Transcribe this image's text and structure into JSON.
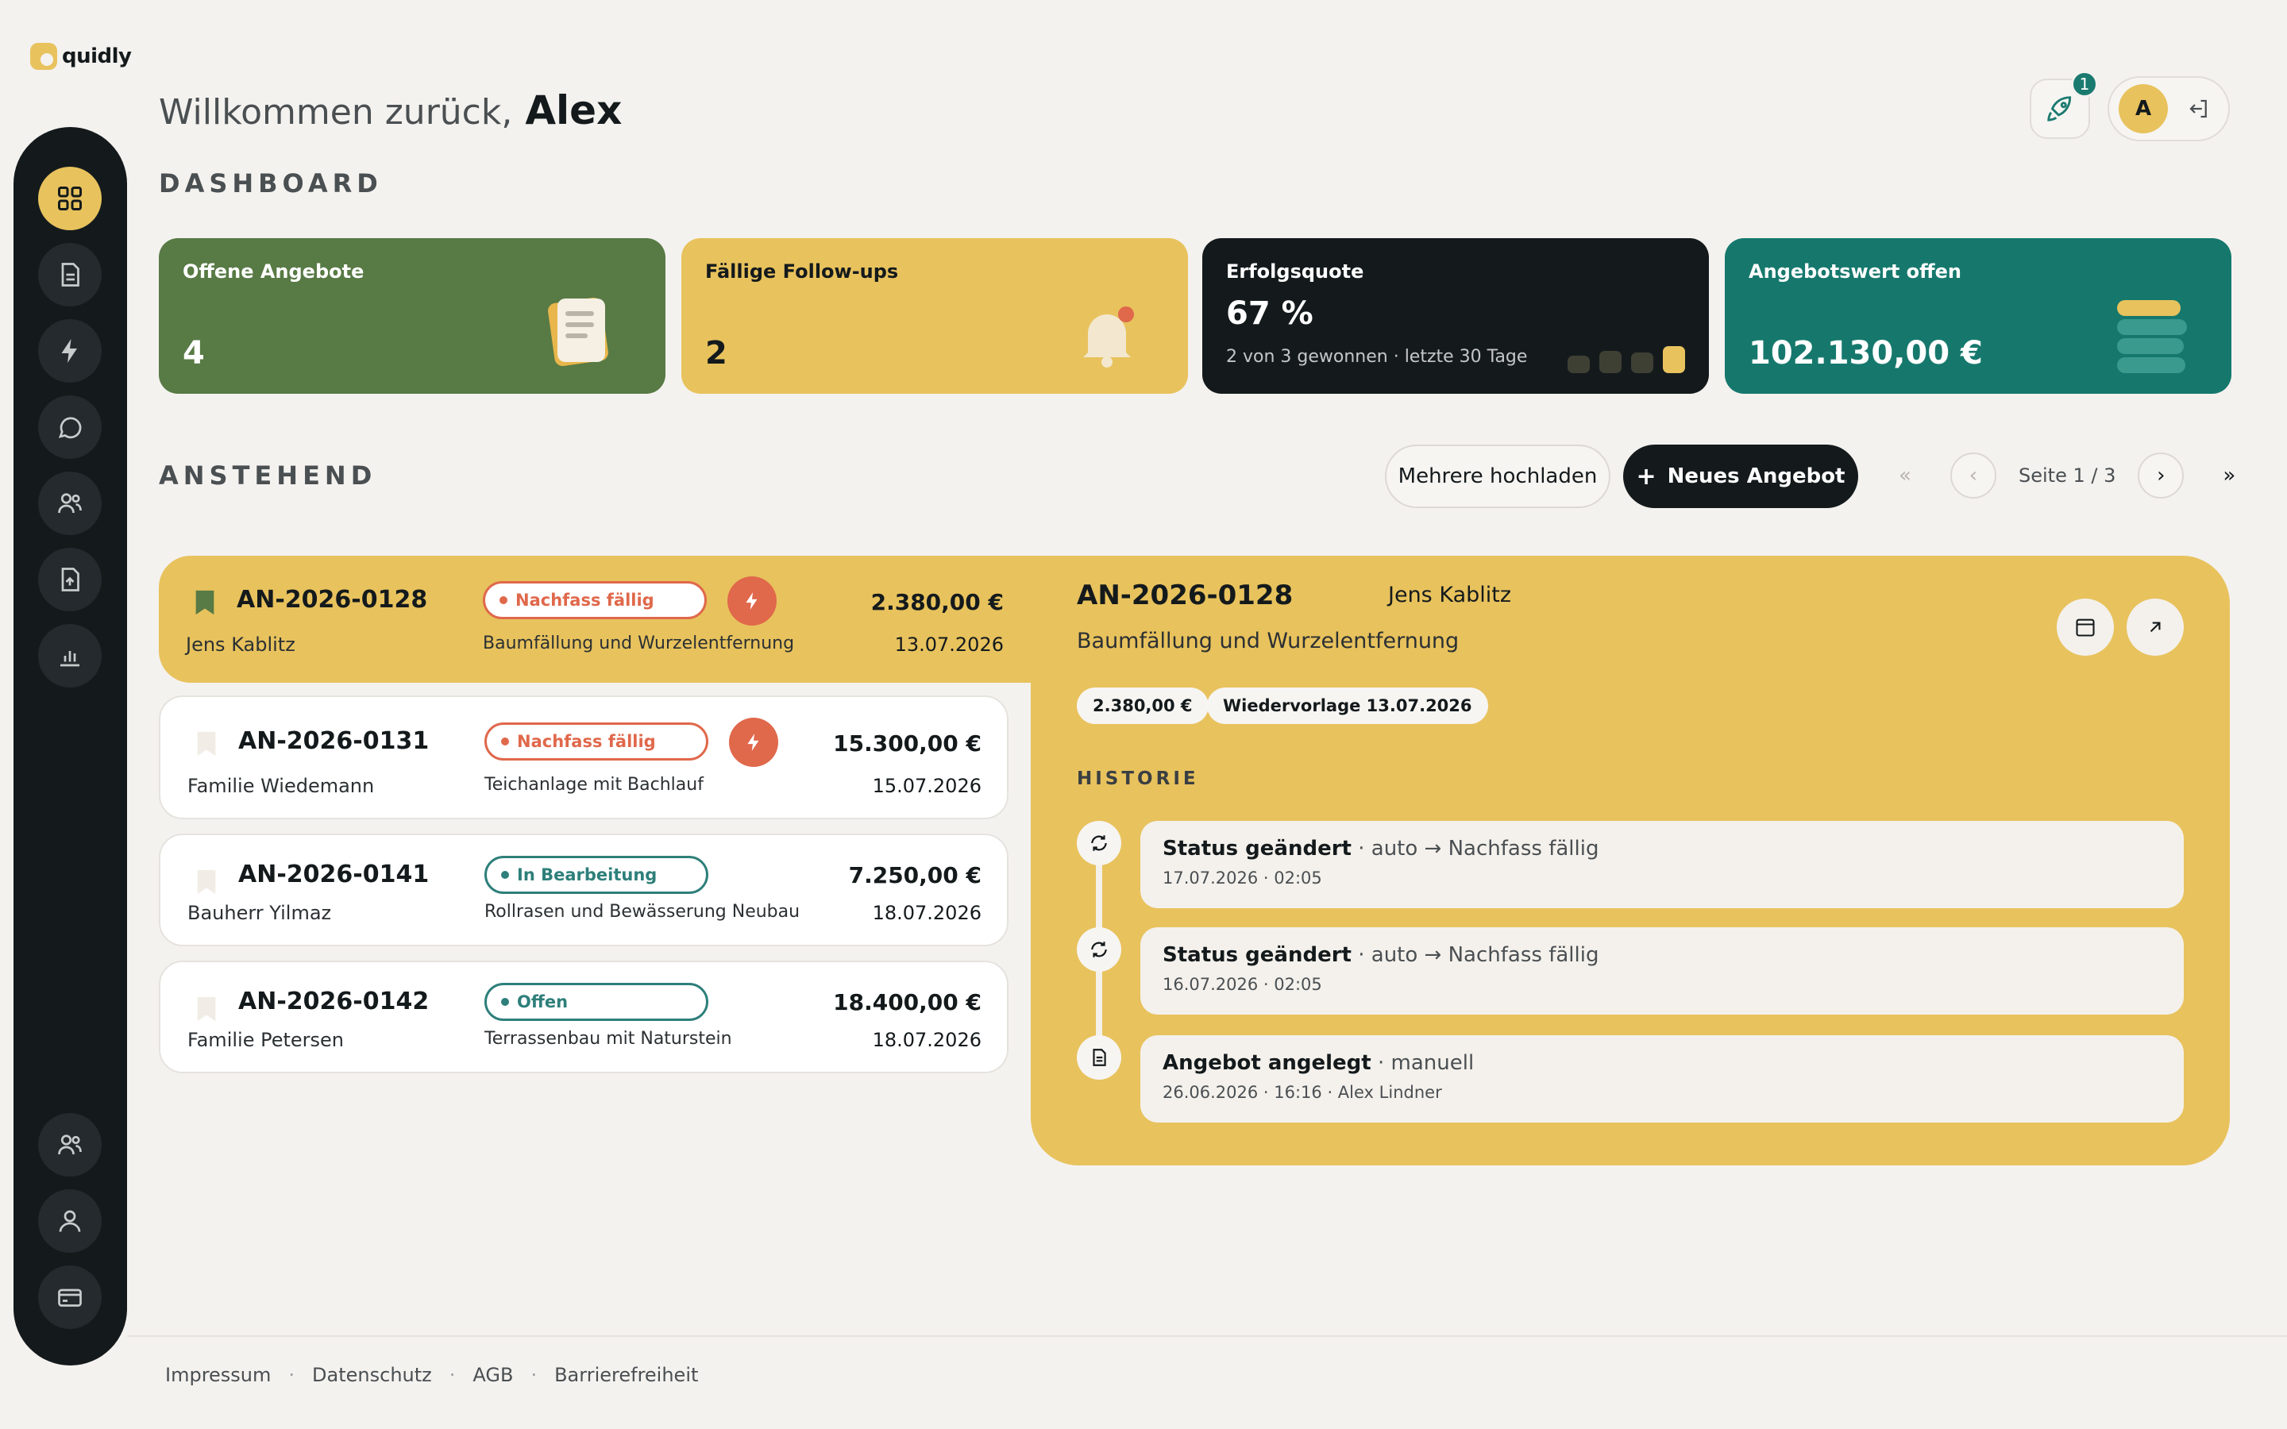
{
  "app": {
    "brand": "quidly"
  },
  "header": {
    "greeting": "Willkommen zurück,",
    "user_name": "Alex",
    "notification_count": "1",
    "avatar_initial": "A"
  },
  "dashboard": {
    "title": "DASHBOARD",
    "cards": [
      {
        "label": "Offene Angebote",
        "value": "4",
        "color": "#587a45"
      },
      {
        "label": "Fällige Follow-ups",
        "value": "2",
        "color": "#e8c25d"
      },
      {
        "label": "Erfolgsquote",
        "value": "67 %",
        "sub": "2 von 3 gewonnen · letzte 30 Tage",
        "color": "#141a1c"
      },
      {
        "label": "Angebotswert offen",
        "value": "102.130,00 €",
        "color": "#16786d"
      }
    ]
  },
  "pending": {
    "title": "ANSTEHEND",
    "upload_label": "Mehrere hochladen",
    "new_label": "Neues Angebot",
    "page_label": "Seite 1 / 3",
    "rows": [
      {
        "id": "AN-2026-0128",
        "customer": "Jens Kablitz",
        "status": "Nachfass fällig",
        "description": "Baumfällung und Wurzelentfernung",
        "amount": "2.380,00 €",
        "date": "13.07.2026"
      },
      {
        "id": "AN-2026-0131",
        "customer": "Familie Wiedemann",
        "status": "Nachfass fällig",
        "description": "Teichanlage mit Bachlauf",
        "amount": "15.300,00 €",
        "date": "15.07.2026"
      },
      {
        "id": "AN-2026-0141",
        "customer": "Bauherr Yilmaz",
        "status": "In Bearbeitung",
        "description": "Rollrasen und Bewässerung Neubau",
        "amount": "7.250,00 €",
        "date": "18.07.2026"
      },
      {
        "id": "AN-2026-0142",
        "customer": "Familie Petersen",
        "status": "Offen",
        "description": "Terrassenbau mit Naturstein",
        "amount": "18.400,00 €",
        "date": "18.07.2026"
      }
    ]
  },
  "detail": {
    "id": "AN-2026-0128",
    "customer": "Jens Kablitz",
    "description": "Baumfällung und Wurzelentfernung",
    "amount_tag": "2.380,00 €",
    "followup_tag": "Wiedervorlage 13.07.2026",
    "history_title": "HISTORIE",
    "history": [
      {
        "title": "Status geändert",
        "detail": " · auto → Nachfass fällig",
        "meta": "17.07.2026 · 02:05",
        "icon": "refresh-icon"
      },
      {
        "title": "Status geändert",
        "detail": " · auto → Nachfass fällig",
        "meta": "16.07.2026 · 02:05",
        "icon": "refresh-icon"
      },
      {
        "title": "Angebot angelegt",
        "detail": " · manuell",
        "meta": "26.06.2026 · 16:16 · Alex Lindner",
        "icon": "document-icon"
      }
    ]
  },
  "footer": {
    "links": [
      "Impressum",
      "Datenschutz",
      "AGB",
      "Barrierefreiheit"
    ]
  }
}
